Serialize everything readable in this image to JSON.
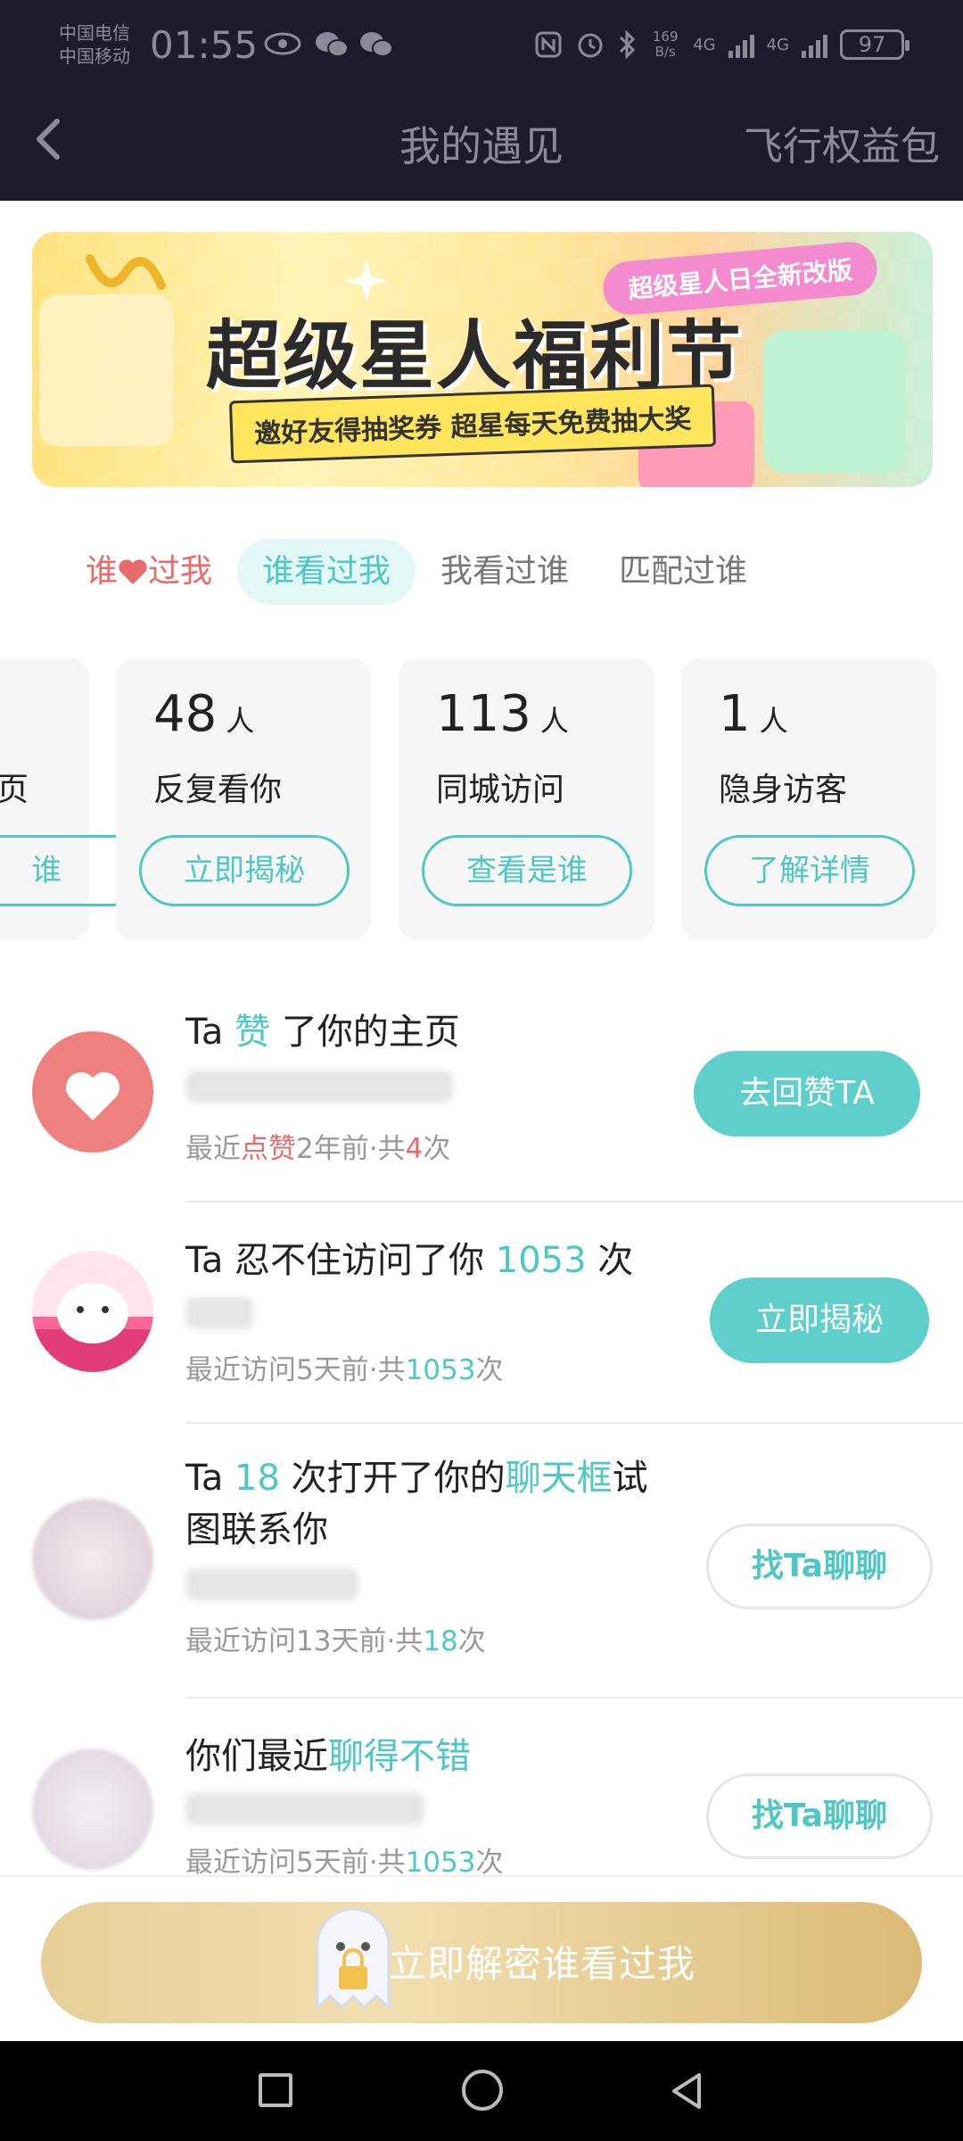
{
  "status_bar": {
    "carrier_1": "中国电信",
    "carrier_2": "中国移动",
    "time": "01:55",
    "net_speed": "169 B/s",
    "signal_1": "4G",
    "signal_2": "4G",
    "battery": "97"
  },
  "header": {
    "title": "我的遇见",
    "right_link": "飞行权益包"
  },
  "banner": {
    "tag": "超级星人日全新改版",
    "title": "超级星人福利节",
    "subtitle": "邀好友得抽奖券 超星每天免费抽大奖"
  },
  "tabs": [
    {
      "label_a": "谁",
      "label_b": "过我",
      "icon": "heart-icon"
    },
    {
      "label": "谁看过我",
      "active": true
    },
    {
      "label": "我看过谁"
    },
    {
      "label": "匹配过谁"
    }
  ],
  "cards": [
    {
      "count": "",
      "unit": "",
      "label": "页",
      "button": "谁"
    },
    {
      "count": "48",
      "unit": "人",
      "label": "反复看你",
      "button": "立即揭秘"
    },
    {
      "count": "113",
      "unit": "人",
      "label": "同城访问",
      "button": "查看是谁"
    },
    {
      "count": "1",
      "unit": "人",
      "label": "隐身访客",
      "button": "了解详情"
    }
  ],
  "items": [
    {
      "title_pre": "Ta ",
      "title_hl": "赞",
      "title_post": " 了你的主页",
      "meta_pre": "最近",
      "meta_hl": "点赞",
      "meta_mid": "2年前·共",
      "meta_count": "4",
      "meta_post": "次",
      "action": "去回赞TA"
    },
    {
      "title_pre": "Ta 忍不住访问了你 ",
      "title_hl": "1053",
      "title_post": " 次",
      "meta_pre": "最近访问5天前·共",
      "meta_count": "1053",
      "meta_post": "次",
      "action": "立即揭秘"
    },
    {
      "title_pre": "Ta ",
      "title_hl": "18",
      "title_mid": " 次打开了你的",
      "title_hl2": "聊天框",
      "title_post": "试",
      "title_line2": "图联系你",
      "meta_pre": "最近访问13天前·共",
      "meta_count": "18",
      "meta_post": "次",
      "action": "找Ta聊聊"
    },
    {
      "title_pre": "你们最近",
      "title_hl": "聊得不错",
      "meta_pre": "最近访问5天前·共",
      "meta_count": "1053",
      "meta_post": "次",
      "action": "找Ta聊聊"
    }
  ],
  "cta": {
    "label": "立即解密谁看过我"
  },
  "colors": {
    "accent": "#4fc7c4",
    "like_red": "#e86b6b",
    "header_bg": "#1d1c2c",
    "cta_gold": "#e2c68a"
  }
}
